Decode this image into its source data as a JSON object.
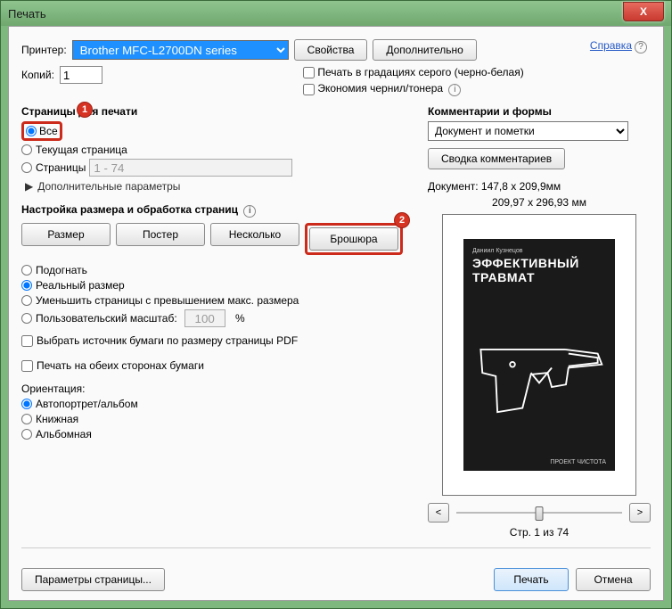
{
  "window": {
    "title": "Печать"
  },
  "closebtn": "X",
  "printer": {
    "label": "Принтер:",
    "selected": "Brother MFC-L2700DN series"
  },
  "buttons": {
    "properties": "Свойства",
    "advanced": "Дополнительно",
    "help": "Справка"
  },
  "copies": {
    "label": "Копий:",
    "value": "1"
  },
  "opts": {
    "grayscale": "Печать в градациях серого (черно-белая)",
    "ink": "Экономия чернил/тонера"
  },
  "pages": {
    "title": "Страницы для печати",
    "all": "Все",
    "current": "Текущая страница",
    "range_label": "Страницы",
    "range_value": "1 - 74",
    "more": "Дополнительные параметры"
  },
  "sizing": {
    "title": "Настройка размера и обработка страниц",
    "t_size": "Размер",
    "t_poster": "Постер",
    "t_multi": "Несколько",
    "t_brochure": "Брошюра",
    "fit": "Подогнать",
    "actual": "Реальный размер",
    "shrink": "Уменьшить страницы с превышением макс. размера",
    "custom": "Пользовательский масштаб:",
    "custom_val": "100",
    "percent": "%",
    "source": "Выбрать источник бумаги по размеру страницы PDF",
    "duplex": "Печать на обеих сторонах бумаги"
  },
  "orient": {
    "title": "Ориентация:",
    "auto": "Автопортрет/альбом",
    "book": "Книжная",
    "album": "Альбомная"
  },
  "comments": {
    "title": "Комментарии и формы",
    "combo": "Документ и пометки",
    "summary": "Сводка комментариев"
  },
  "preview": {
    "doc": "Документ: 147,8 x 209,9мм",
    "page": "209,97 x 296,93 мм",
    "author": "Даниил Кузнецов",
    "line1": "ЭФФЕКТИВНЫЙ",
    "line2": "ТРАВМАТ",
    "project": "ПРОЕКТ ЧИСТОТА",
    "prev": "<",
    "next": ">",
    "counter": "Стр. 1 из 74"
  },
  "footer": {
    "pagesetup": "Параметры страницы...",
    "print": "Печать",
    "cancel": "Отмена"
  },
  "callouts": {
    "c1": "1",
    "c2": "2"
  }
}
